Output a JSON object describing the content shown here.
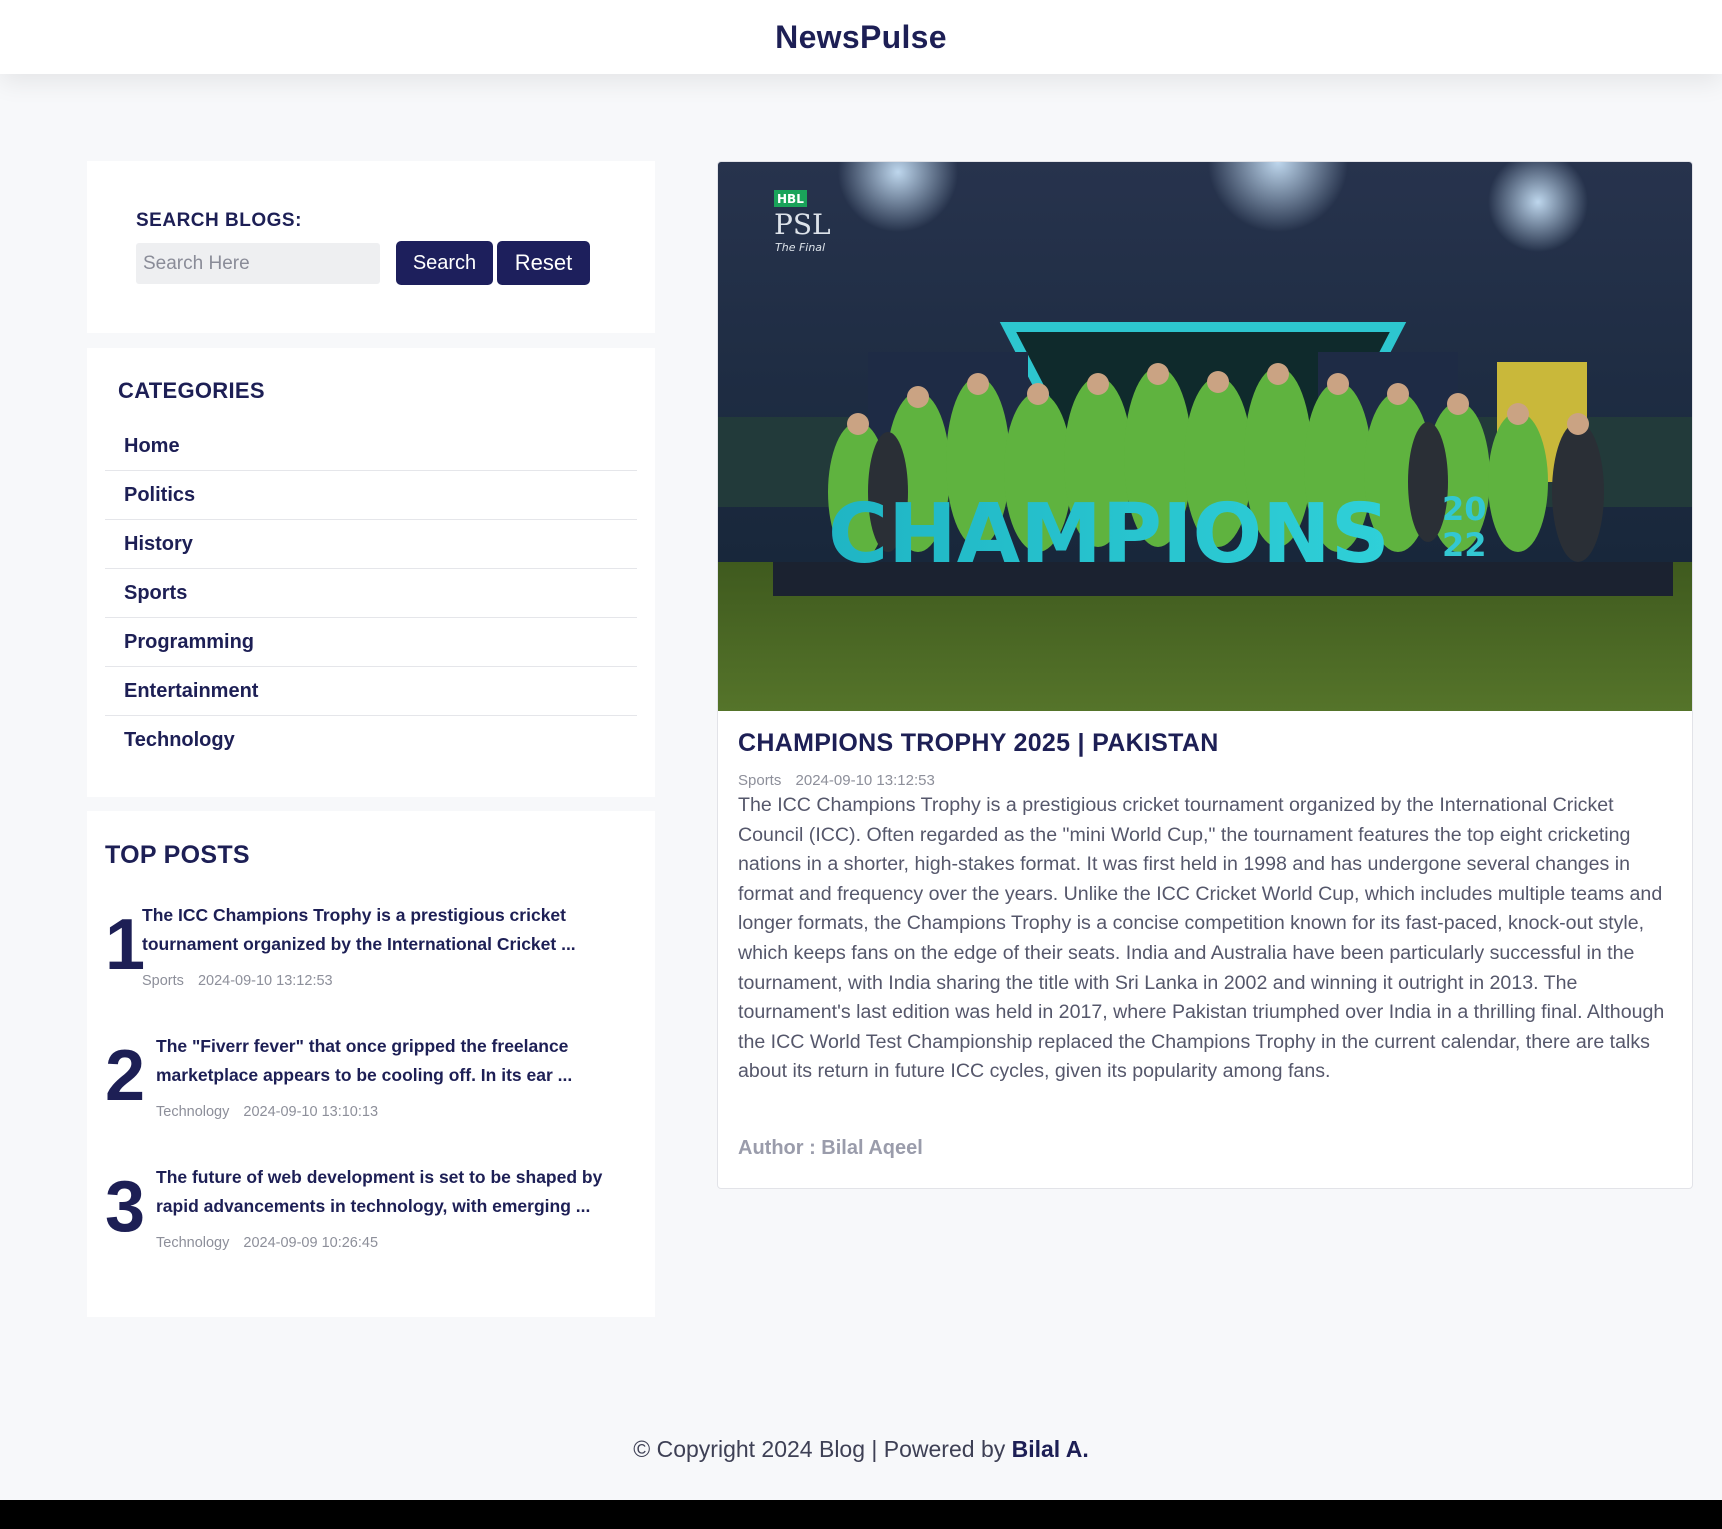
{
  "header": {
    "brand": "NewsPulse"
  },
  "search": {
    "heading": "SEARCH BLOGS:",
    "placeholder": "Search Here",
    "value": "",
    "search_label": "Search",
    "reset_label": "Reset"
  },
  "categories": {
    "heading": "CATEGORIES",
    "items": [
      {
        "label": "Home"
      },
      {
        "label": "Politics"
      },
      {
        "label": "History"
      },
      {
        "label": "Sports"
      },
      {
        "label": "Programming"
      },
      {
        "label": "Entertainment"
      },
      {
        "label": "Technology"
      }
    ]
  },
  "top_posts": {
    "heading": "TOP POSTS",
    "items": [
      {
        "rank": "1",
        "excerpt": "The ICC Champions Trophy is a prestigious cricket tournament organized by the International Cricket ...",
        "category": "Sports",
        "date": "2024-09-10 13:12:53"
      },
      {
        "rank": "2",
        "excerpt": "The \"Fiverr fever\" that once gripped the freelance marketplace appears to be cooling off. In its ear ...",
        "category": "Technology",
        "date": "2024-09-10 13:10:13"
      },
      {
        "rank": "3",
        "excerpt": "The future of web development is set to be shaped by rapid advancements in technology, with emerging ...",
        "category": "Technology",
        "date": "2024-09-09 10:26:45"
      }
    ]
  },
  "article": {
    "image_text": {
      "logo_badge": "HBL",
      "logo_name": "PSL",
      "logo_sub": "The Final",
      "banner": "CHAMPIONS",
      "banner_year_top": "20",
      "banner_year_bottom": "22"
    },
    "title": "CHAMPIONS TROPHY 2025 | PAKISTAN",
    "category": "Sports",
    "date": "2024-09-10 13:12:53",
    "body": "The ICC Champions Trophy is a prestigious cricket tournament organized by the International Cricket Council (ICC). Often regarded as the \"mini World Cup,\" the tournament features the top eight cricketing nations in a shorter, high-stakes format. It was first held in 1998 and has undergone several changes in format and frequency over the years. Unlike the ICC Cricket World Cup, which includes multiple teams and longer formats, the Champions Trophy is a concise competition known for its fast-paced, knock-out style, which keeps fans on the edge of their seats. India and Australia have been particularly successful in the tournament, with India sharing the title with Sri Lanka in 2002 and winning it outright in 2013. The tournament's last edition was held in 2017, where Pakistan triumphed over India in a thrilling final. Although the ICC World Test Championship replaced the Champions Trophy in the current calendar, there are talks about its return in future ICC cycles, given its popularity among fans.",
    "author": "Author : Bilal Aqeel"
  },
  "footer": {
    "text": "© Copyright 2024 Blog | Powered by ",
    "author": "Bilal A."
  },
  "colors": {
    "navy": "#1d1f55",
    "button": "#1d1f5c",
    "page_bg": "#f7f8fa",
    "muted": "#8d8f9a"
  }
}
